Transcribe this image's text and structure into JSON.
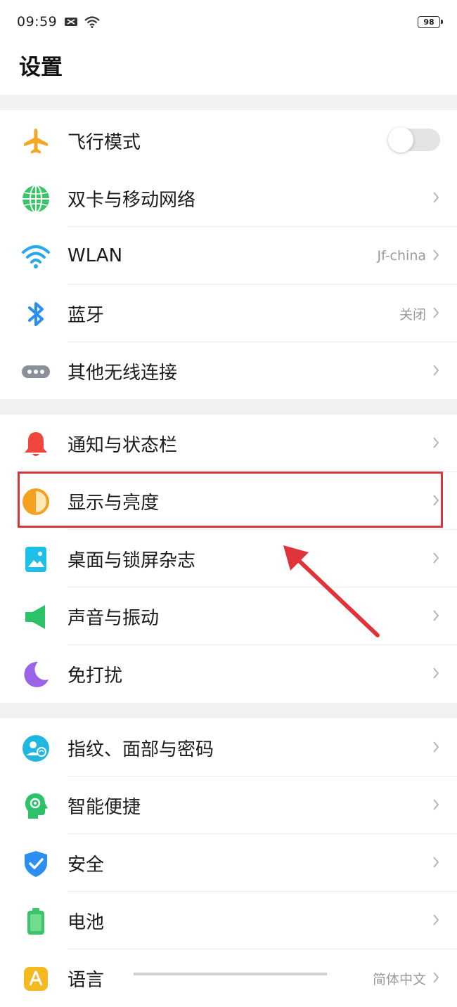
{
  "status_bar": {
    "time": "09:59",
    "battery": "98",
    "icons": [
      "message-icon",
      "wifi-icon"
    ]
  },
  "page": {
    "title": "设置"
  },
  "groups": [
    {
      "items": [
        {
          "label": "飞行模式",
          "icon": "airplane-icon",
          "control": "toggle",
          "toggle_on": false
        },
        {
          "label": "双卡与移动网络",
          "icon": "globe-icon",
          "control": "chevron"
        },
        {
          "label": "WLAN",
          "icon": "wifi-icon",
          "value": "Jf-china",
          "control": "chevron"
        },
        {
          "label": "蓝牙",
          "icon": "bluetooth-icon",
          "value": "关闭",
          "control": "chevron"
        },
        {
          "label": "其他无线连接",
          "icon": "more-dots-icon",
          "control": "chevron"
        }
      ]
    },
    {
      "items": [
        {
          "label": "通知与状态栏",
          "icon": "bell-icon",
          "control": "chevron"
        },
        {
          "label": "显示与亮度",
          "icon": "brightness-icon",
          "control": "chevron",
          "highlighted": true
        },
        {
          "label": "桌面与锁屏杂志",
          "icon": "wallpaper-icon",
          "control": "chevron"
        },
        {
          "label": "声音与振动",
          "icon": "speaker-icon",
          "control": "chevron"
        },
        {
          "label": "免打扰",
          "icon": "moon-icon",
          "control": "chevron"
        }
      ]
    },
    {
      "items": [
        {
          "label": "指纹、面部与密码",
          "icon": "fingerprint-icon",
          "control": "chevron"
        },
        {
          "label": "智能便捷",
          "icon": "smart-assist-icon",
          "control": "chevron"
        },
        {
          "label": "安全",
          "icon": "shield-icon",
          "control": "chevron"
        },
        {
          "label": "电池",
          "icon": "battery-icon",
          "control": "chevron"
        },
        {
          "label": "语言",
          "icon": "language-icon",
          "value": "简体中文",
          "control": "chevron"
        }
      ]
    }
  ],
  "colors": {
    "airplane": "#f5a623",
    "globe": "#3cc46a",
    "wifi": "#26a8f0",
    "bluetooth": "#2b8ef0",
    "dots": "#8a8f99",
    "bell": "#f0463e",
    "brightness": "#f5a01e",
    "wallpaper": "#1ec0e8",
    "speaker": "#2cc26a",
    "moon": "#9b63e8",
    "fingerprint": "#20b8e0",
    "smart": "#2cc26a",
    "shield": "#2b8ef0",
    "battery": "#3cc46a",
    "language": "#f5b81e",
    "highlight": "#d9343a"
  }
}
